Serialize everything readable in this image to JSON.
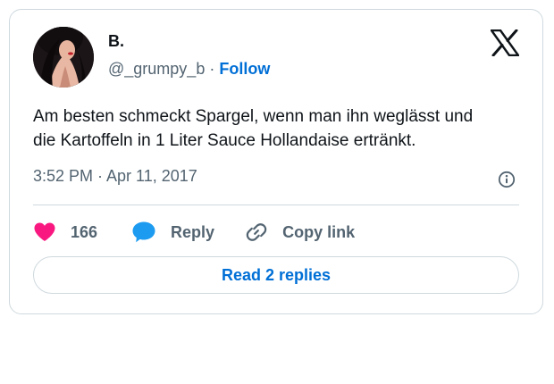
{
  "tweet": {
    "author": {
      "display_name": "B.",
      "handle": "@_grumpy_b",
      "separator": "·",
      "follow_label": "Follow"
    },
    "text_line_1": "Am besten schmeckt Spargel, wenn man ihn weglässt und",
    "text_line_2": "die Kartoffeln in 1 Liter Sauce Hollandaise ertränkt.",
    "timestamp": "3:52 PM · Apr 11, 2017",
    "actions": {
      "like_count": "166",
      "reply_label": "Reply",
      "copy_link_label": "Copy link"
    },
    "read_replies_label": "Read 2 replies"
  },
  "icons": {
    "logo": "x-logo-icon",
    "info": "info-icon",
    "like": "heart-icon",
    "reply": "speech-bubble-icon",
    "copy": "link-icon"
  },
  "colors": {
    "like": "#f91880",
    "reply": "#1d9bf0",
    "link": "#006fd6",
    "muted": "#536471",
    "border": "#cfd9de"
  }
}
